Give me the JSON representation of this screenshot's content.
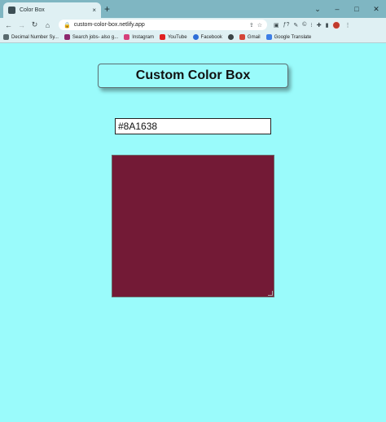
{
  "browser": {
    "tab_title": "Color Box",
    "tab_close": "×",
    "new_tab": "+",
    "url": "custom-color-box.netlify.app",
    "window_controls": [
      "⌄",
      "–",
      "□",
      "✕"
    ],
    "bookmarks": [
      {
        "label": "Decimal Number Sy...",
        "icon": "apps-icon",
        "color": "#5a6a6e"
      },
      {
        "label": "Search jobs- also g...",
        "icon": "jobs-icon",
        "color": "#8e2a6e"
      },
      {
        "label": "Instagram",
        "icon": "instagram-icon",
        "color": "#d6407a"
      },
      {
        "label": "YouTube",
        "icon": "youtube-icon",
        "color": "#e02020"
      },
      {
        "label": "Facebook",
        "icon": "facebook-icon",
        "color": "#2d6ed8"
      },
      {
        "label": "",
        "icon": "globe-icon",
        "color": "#3b4446"
      },
      {
        "label": "Gmail",
        "icon": "gmail-icon",
        "color": "#d44638"
      },
      {
        "label": "Google Translate",
        "icon": "translate-icon",
        "color": "#3d7ee6"
      }
    ]
  },
  "page": {
    "title": "Custom Color Box",
    "color_input_value": "#8A1638",
    "box_color": "#731a36",
    "background_color": "#9afbfb"
  }
}
